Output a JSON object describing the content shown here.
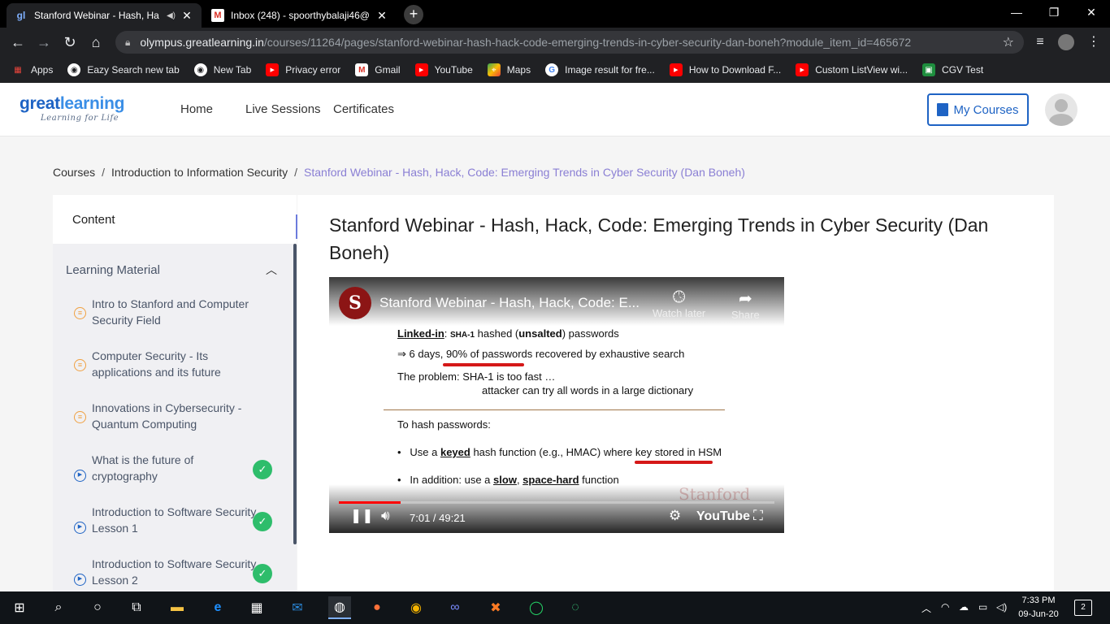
{
  "browser": {
    "tabs": [
      {
        "title": "Stanford Webinar - Hash, Ha",
        "favicon": "gl-favicon",
        "active": true
      },
      {
        "title": "Inbox (248) - spoorthybalaji46@",
        "favicon": "gmail-icon",
        "active": false
      }
    ],
    "url_host": "olympus.greatlearning.in",
    "url_path": "/courses/11264/pages/stanford-webinar-hash-hack-code-emerging-trends-in-cyber-security-dan-boneh?module_item_id=465672",
    "bookmarks": [
      {
        "label": "Apps",
        "icon": "apps-grid-icon"
      },
      {
        "label": "Eazy Search new tab",
        "icon": "globe-icon"
      },
      {
        "label": "New Tab",
        "icon": "globe-icon"
      },
      {
        "label": "Privacy error",
        "icon": "youtube-icon"
      },
      {
        "label": "Gmail",
        "icon": "gmail-icon"
      },
      {
        "label": "YouTube",
        "icon": "youtube-icon"
      },
      {
        "label": "Maps",
        "icon": "maps-icon"
      },
      {
        "label": "Image result for fre...",
        "icon": "google-icon"
      },
      {
        "label": "How to Download F...",
        "icon": "youtube-icon"
      },
      {
        "label": "Custom ListView wi...",
        "icon": "youtube-icon"
      },
      {
        "label": "CGV Test",
        "icon": "classroom-icon"
      }
    ]
  },
  "header": {
    "logo_brand_a": "great",
    "logo_brand_b": "learning",
    "logo_tagline": "Learning for Life",
    "nav": [
      "Home",
      "Live Sessions",
      "Certificates"
    ],
    "my_courses": "My Courses"
  },
  "breadcrumb": {
    "items": [
      "Courses",
      "Introduction to Information Security",
      "Stanford Webinar - Hash, Hack, Code: Emerging Trends in Cyber Security (Dan Boneh)"
    ],
    "separator": "/"
  },
  "sidebar": {
    "content_label": "Content",
    "section_label": "Learning Material",
    "lessons": [
      {
        "title": "Intro to Stanford and Computer Security Field",
        "type": "document",
        "completed": false
      },
      {
        "title": "Computer Security - Its applications and its future",
        "type": "document",
        "completed": false
      },
      {
        "title": "Innovations in Cybersecurity - Quantum Computing",
        "type": "document",
        "completed": false
      },
      {
        "title": "What is the future of cryptography",
        "type": "video",
        "completed": true
      },
      {
        "title": "Introduction to Software Security Lesson 1",
        "type": "video",
        "completed": true
      },
      {
        "title": "Introduction to Software Security Lesson 2",
        "type": "video",
        "completed": true
      }
    ]
  },
  "main": {
    "title": "Stanford Webinar - Hash, Hack, Code: Emerging Trends in Cyber Security (Dan Boneh)",
    "video": {
      "title": "Stanford Webinar - Hash, Hack, Code: E...",
      "watch_later": "Watch later",
      "share": "Share",
      "time": "7:01 / 49:21",
      "progress": 0.142,
      "brand": "YouTube",
      "watermark": "Stanford",
      "slide": {
        "line1_a": "Linked-in",
        "line1_b": ": ",
        "line1_c": "SHA-1",
        "line1_d": " hashed (",
        "line1_e": "unsalted",
        "line1_f": ") passwords",
        "line2": "⇒  6 days, 90% of passwords recovered by exhaustive search",
        "line3": "The problem:  SHA-1 is too fast  …",
        "line4": "attacker can try all words in a large dictionary",
        "line5": "To hash passwords:",
        "line6_a": "Use a ",
        "line6_b": "keyed",
        "line6_c": " hash function (e.g., HMAC) where key stored in HSM",
        "line7_a": "In addition: use a  ",
        "line7_b": "slow",
        "line7_c": ",  ",
        "line7_d": "space-hard",
        "line7_e": "  function"
      }
    }
  },
  "taskbar": {
    "time": "7:33 PM",
    "date": "09-Jun-20",
    "notifications": "2"
  },
  "colors": {
    "brand_blue": "#1e63c4",
    "breadcrumb_current": "#8a7fd4",
    "check_green": "#2ebd6b",
    "collapse_button": "#6c7bdc"
  }
}
